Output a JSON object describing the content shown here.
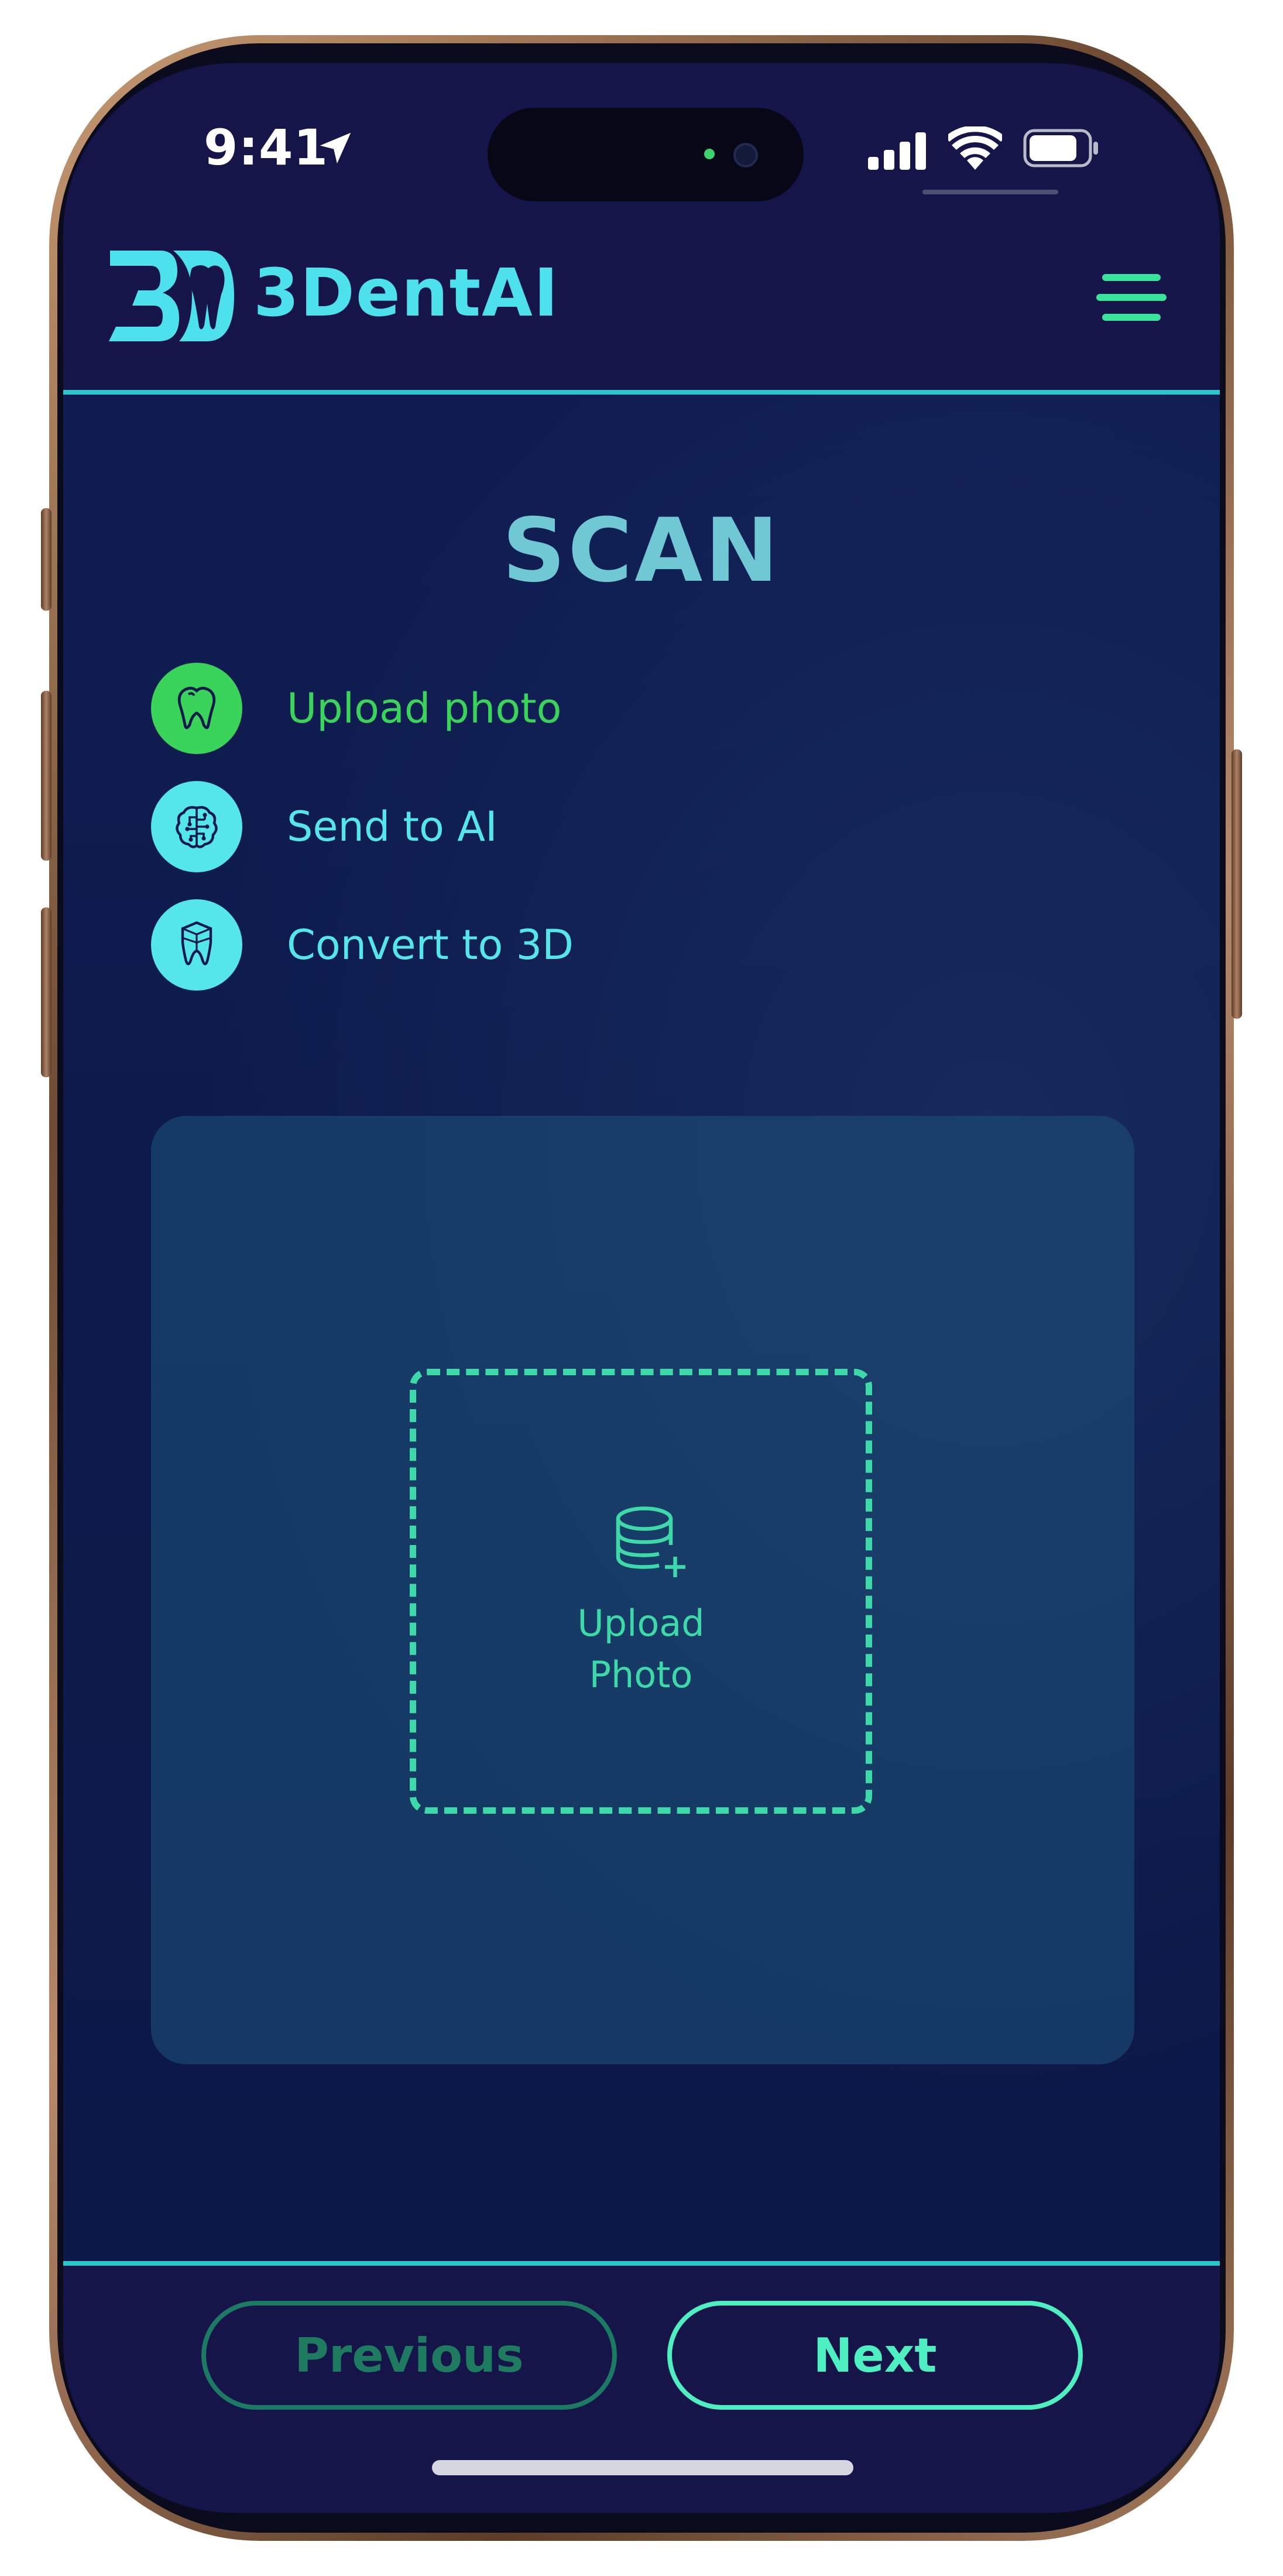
{
  "status_bar": {
    "time": "9:41",
    "icons": [
      "location-arrow-icon",
      "cellular-signal-icon",
      "wifi-icon",
      "battery-icon"
    ]
  },
  "header": {
    "logo_icon": "3d-tooth-logo",
    "brand": "3DentAI",
    "menu_icon": "hamburger-menu-icon"
  },
  "page": {
    "title": "SCAN"
  },
  "steps": [
    {
      "label": "Upload photo",
      "icon": "tooth-icon",
      "state": "active",
      "color": "#3ad45a"
    },
    {
      "label": "Send to AI",
      "icon": "brain-circuit-icon",
      "state": "pending",
      "color": "#55e6ec"
    },
    {
      "label": "Convert to 3D",
      "icon": "3d-tooth-icon",
      "state": "pending",
      "color": "#55e6ec"
    }
  ],
  "upload": {
    "icon": "database-add-icon",
    "line1": "Upload",
    "line2": "Photo"
  },
  "footer": {
    "previous_label": "Previous",
    "next_label": "Next"
  },
  "colors": {
    "accent": "#4ef0c2",
    "brand": "#4de1ee",
    "active_step": "#3ad45a",
    "background": "#16154a"
  }
}
